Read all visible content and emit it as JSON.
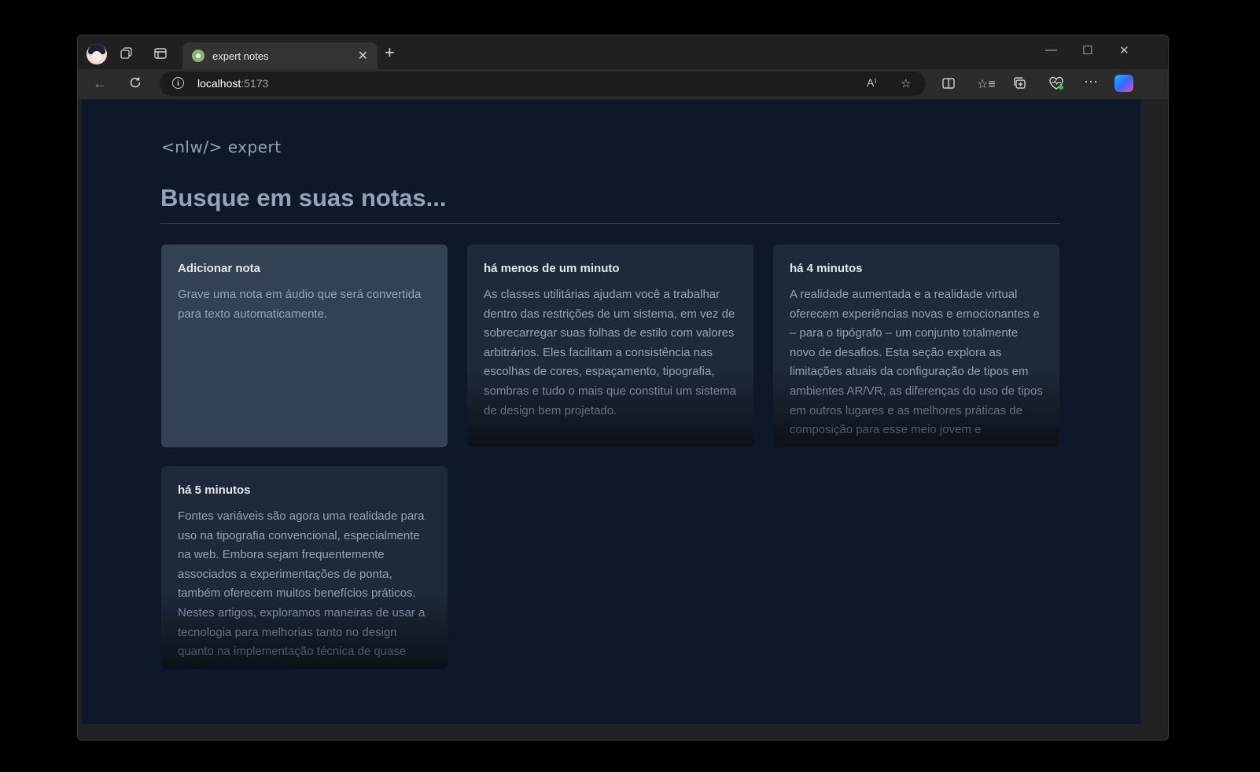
{
  "browser": {
    "tab_title": "expert notes",
    "url_host": "localhost",
    "url_port": ":5173"
  },
  "app": {
    "logo_text": "<nlw/> expert",
    "search_placeholder": "Busque em suas notas..."
  },
  "add_card": {
    "title": "Adicionar nota",
    "text": "Grave uma nota em áudio que será convertida para texto automaticamente."
  },
  "notes": [
    {
      "date": "há menos de um minuto",
      "content": "As classes utilitárias ajudam você a trabalhar dentro das restrições de um sistema, em vez de sobrecarregar suas folhas de estilo com valores arbitrários. Eles facilitam a consistência nas escolhas de cores, espaçamento, tipografia, sombras e tudo o mais que constitui um sistema de design bem projetado."
    },
    {
      "date": "há 4 minutos",
      "content": "A realidade aumentada e a realidade virtual oferecem experiências novas e emocionantes e – para o tipógrafo – um conjunto totalmente novo de desafios. Esta seção explora as limitações atuais da configuração de tipos em ambientes AR/VR, as diferenças do uso de tipos em outros lugares e as melhores práticas de composição para esse meio jovem e"
    },
    {
      "date": "há 5 minutos",
      "content": "Fontes variáveis são agora uma realidade para uso na tipografia convencional, especialmente na web. Embora sejam frequentemente associados a experimentações de ponta, também oferecem muitos benefícios práticos. Nestes artigos, exploramos maneiras de usar a tecnologia para melhorias tanto no design quanto na implementação técnica de quase"
    }
  ],
  "icons": {
    "profile": "avatar-icon",
    "workspaces": "workspaces-icon",
    "tab_actions": "tab-actions-icon",
    "back": "back-arrow-icon",
    "refresh": "refresh-icon",
    "info": "info-icon",
    "read_aloud": "read-aloud-icon",
    "favorite": "star-icon",
    "split": "split-screen-icon",
    "favorites_list": "favorites-icon",
    "collections": "collections-icon",
    "health": "browser-essentials-icon",
    "more": "more-icon",
    "copilot": "copilot-icon"
  },
  "colors": {
    "app_bg": "#0f172a",
    "card_bg": "#1e293b",
    "add_card_bg": "#334155",
    "text_muted": "#94a3b8"
  }
}
